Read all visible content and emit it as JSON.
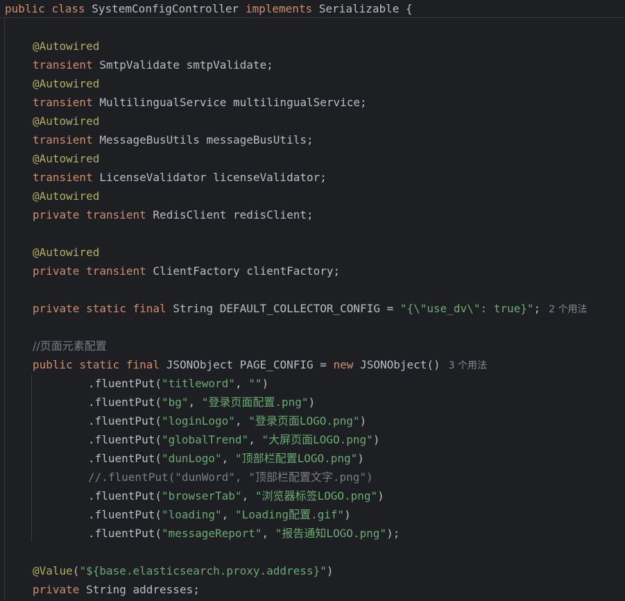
{
  "header": {
    "k1": "public",
    "k2": "class",
    "name": "SystemConfigController",
    "k3": "implements",
    "iface": "Serializable",
    "brace": "{"
  },
  "kw": {
    "autowired": "@Autowired",
    "transient": "transient",
    "private": "private",
    "public": "public",
    "static": "static",
    "final": "final",
    "new": "new",
    "value": "@Value"
  },
  "fields": {
    "smtp": "SmtpValidate smtpValidate;",
    "multi": "MultilingualService multilingualService;",
    "msgbus": "MessageBusUtils messageBusUtils;",
    "license": "LicenseValidator licenseValidator;",
    "redis": "RedisClient redisClient;",
    "client": "ClientFactory clientFactory;"
  },
  "collector": {
    "decl": "String DEFAULT_COLLECTOR_CONFIG = ",
    "value": "\"{\\\"use_dv\\\": true}\"",
    "semi": ";",
    "hint": "2 个用法"
  },
  "page": {
    "comment": "//页面元素配置",
    "decl": "JSONObject PAGE_CONFIG = ",
    "ctor": "JSONObject()",
    "hint": "3 个用法",
    "put": ".fluentPut(",
    "sep": ", ",
    "close": ")",
    "close_last": ");",
    "commented": "//.fluentPut(\"dunWord\", \"顶部栏配置文字.png\")",
    "entries": [
      {
        "key": "\"titleword\"",
        "val": "\"\""
      },
      {
        "key": "\"bg\"",
        "val": "\"登录页面配置.png\""
      },
      {
        "key": "\"loginLogo\"",
        "val": "\"登录页面LOGO.png\""
      },
      {
        "key": "\"globalTrend\"",
        "val": "\"大屏页面LOGO.png\""
      },
      {
        "key": "\"dunLogo\"",
        "val": "\"顶部栏配置LOGO.png\""
      },
      {
        "key": "\"browserTab\"",
        "val": "\"浏览器标签LOGO.png\""
      },
      {
        "key": "\"loading\"",
        "val": "\"Loading配置.gif\""
      },
      {
        "key": "\"messageReport\"",
        "val": "\"报告通知LOGO.png\""
      }
    ]
  },
  "value_line": {
    "open": "(",
    "str": "\"${base.elasticsearch.proxy.address}\"",
    "close": ")"
  },
  "addresses": "String addresses;"
}
